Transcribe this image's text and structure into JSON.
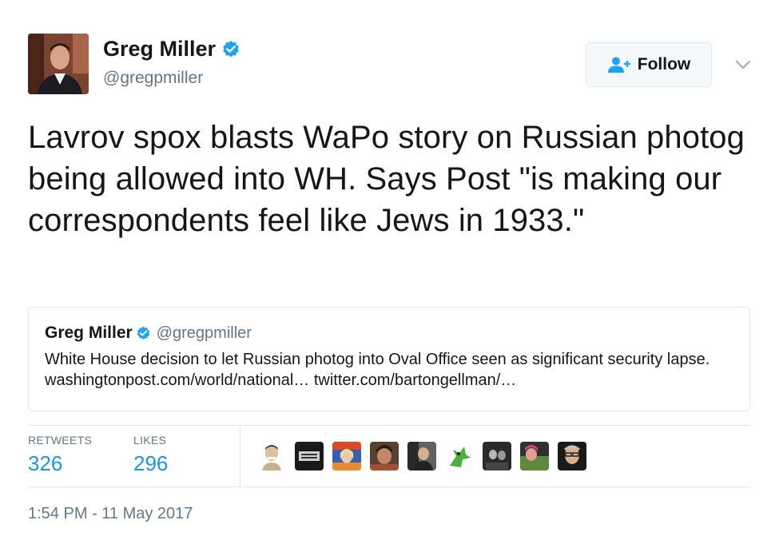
{
  "author": {
    "name": "Greg Miller",
    "handle": "@gregpmiller"
  },
  "follow_button": {
    "label": "Follow"
  },
  "tweet": {
    "text": "Lavrov spox blasts WaPo story on Russian photog being allowed into WH. Says Post \"is making our correspondents feel like Jews in 1933.\""
  },
  "quoted_tweet": {
    "name": "Greg Miller",
    "handle": "@gregpmiller",
    "text": "White House decision to let Russian photog into Oval Office seen as significant security lapse. washingtonpost.com/world/national… twitter.com/bartongellman/…"
  },
  "stats": {
    "retweets_label": "RETWEETS",
    "retweets": "326",
    "likes_label": "LIKES",
    "likes": "296"
  },
  "timestamp": "1:54 PM - 11 May 2017",
  "colors": {
    "link_blue": "#1b95e0",
    "verified_blue": "#1da1f2",
    "secondary_text": "#657786",
    "border": "#e1e8ed"
  }
}
